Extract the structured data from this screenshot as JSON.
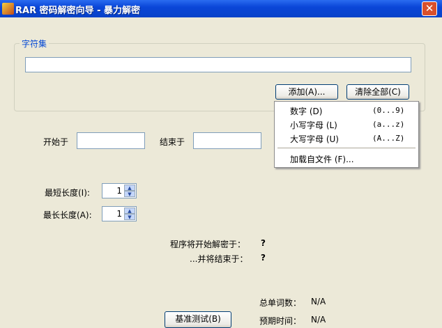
{
  "window": {
    "title": "RAR 密码解密向导 - 暴力解密",
    "close": "✕"
  },
  "charset": {
    "label": "字符集",
    "value": "",
    "add_button": "添加(A)...",
    "clear_button": "清除全部(C)"
  },
  "menu": {
    "items": [
      {
        "label": "数字 (D)",
        "range": "(0...9)"
      },
      {
        "label": "小写字母 (L)",
        "range": "(a...z)"
      },
      {
        "label": "大写字母 (U)",
        "range": "(A...Z)"
      }
    ],
    "load_file": "加载自文件 (F)..."
  },
  "range": {
    "start_label": "开始于",
    "start_value": "",
    "end_label": "结束于",
    "end_value": ""
  },
  "length": {
    "min_label": "最短长度(I):",
    "min_value": "1",
    "max_label": "最长长度(A):",
    "max_value": "1"
  },
  "info": {
    "start_label": "程序将开始解密于：",
    "start_value": "?",
    "end_label": "...并将结束于：",
    "end_value": "?",
    "words_label": "总单词数：",
    "words_value": "N/A",
    "time_label": "预期时间：",
    "time_value": "N/A"
  },
  "benchmark_button": "基准测试(B)"
}
